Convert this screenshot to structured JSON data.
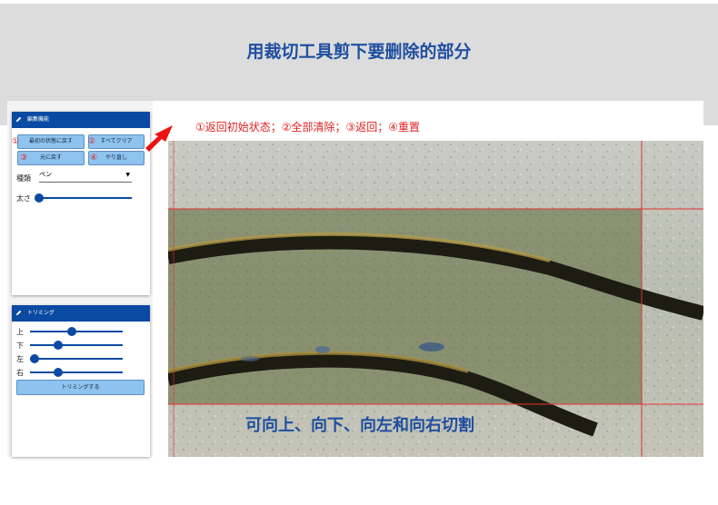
{
  "banner": {
    "title": "用裁切工具剪下要删除的部分"
  },
  "annotations": {
    "top": "①返回初始状态；②全部清除；③返回；④重置",
    "bottom": "可向上、向下、向左和向右切割"
  },
  "edit_panel": {
    "title": "編集機能",
    "buttons": {
      "reset_initial": "最初の状態に戻す",
      "clear_all": "すべてクリア",
      "undo": "元に戻す",
      "redo": "やり直し"
    },
    "numbers": {
      "n1": "①",
      "n2": "②",
      "n3": "③",
      "n4": "④"
    },
    "type_label": "種類",
    "type_value": "ペン",
    "thickness_label": "太さ",
    "thickness_value": 0.0
  },
  "trim_panel": {
    "title": "トリミング",
    "labels": {
      "top": "上",
      "bottom": "下",
      "left": "左",
      "right": "右"
    },
    "values": {
      "top": 0.45,
      "bottom": 0.3,
      "left": 0.05,
      "right": 0.3
    },
    "button": "トリミングする"
  },
  "colors": {
    "accent": "#0b4aa2",
    "annotation_red": "#e02020",
    "annotation_blue": "#1f4fa0",
    "button": "#8ec3f0"
  },
  "icons": {
    "panel_icon": "pen-icon",
    "pointer": "red-arrow-icon"
  }
}
